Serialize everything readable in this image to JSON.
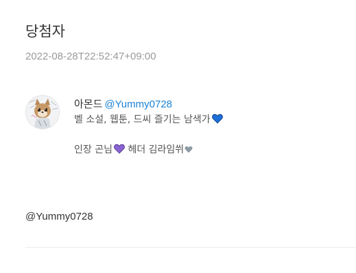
{
  "header": {
    "title": "당첨자",
    "timestamp": "2022-08-28T22:52:47+09:00"
  },
  "profile": {
    "display_name": "아몬드",
    "handle": "@Yummy0728",
    "bio_line1": "벨 소설, 웹툰, 드씨 즐기는 남색가",
    "bio_line2_part1": "인장 곤님",
    "bio_line2_part2": "헤더 김라임쒸",
    "hearts": {
      "blue": {
        "icon": "blue-heart-icon",
        "color": "#1d6fd8"
      },
      "purple": {
        "icon": "purple-heart-icon",
        "color": "#8a63d2"
      },
      "grey": {
        "icon": "grey-heart-icon",
        "color": "#8e9aa3"
      }
    }
  },
  "footer": {
    "handle": "@Yummy0728"
  },
  "colors": {
    "link": "#1d82d6",
    "text": "#333333",
    "muted": "#9a9a9a"
  }
}
